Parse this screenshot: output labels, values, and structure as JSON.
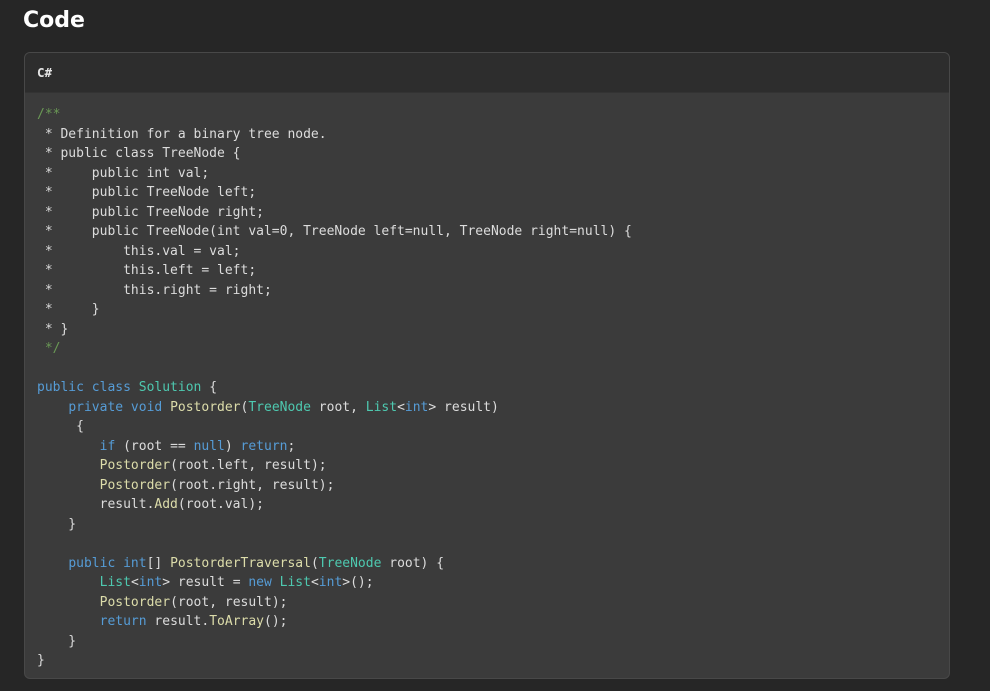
{
  "page": {
    "heading": "Code"
  },
  "code_block": {
    "language": "C#",
    "colors": {
      "plain": "#dcdcdc",
      "keyword": "#569cd6",
      "type": "#4ec9b0",
      "func": "#dcdcaa",
      "comment": "#6a9955"
    },
    "lines": [
      [
        [
          "comment",
          "/**"
        ]
      ],
      [
        [
          "plain",
          " * Definition for a binary tree node."
        ]
      ],
      [
        [
          "plain",
          " * public class TreeNode {"
        ]
      ],
      [
        [
          "plain",
          " *     public int val;"
        ]
      ],
      [
        [
          "plain",
          " *     public TreeNode left;"
        ]
      ],
      [
        [
          "plain",
          " *     public TreeNode right;"
        ]
      ],
      [
        [
          "plain",
          " *     public TreeNode(int val=0, TreeNode left=null, TreeNode right=null) {"
        ]
      ],
      [
        [
          "plain",
          " *         this.val = val;"
        ]
      ],
      [
        [
          "plain",
          " *         this.left = left;"
        ]
      ],
      [
        [
          "plain",
          " *         this.right = right;"
        ]
      ],
      [
        [
          "plain",
          " *     }"
        ]
      ],
      [
        [
          "plain",
          " * }"
        ]
      ],
      [
        [
          "comment",
          " */"
        ]
      ],
      [],
      [
        [
          "keyword",
          "public class "
        ],
        [
          "type",
          "Solution"
        ],
        [
          "plain",
          " {"
        ]
      ],
      [
        [
          "plain",
          "    "
        ],
        [
          "keyword",
          "private void "
        ],
        [
          "func",
          "Postorder"
        ],
        [
          "plain",
          "("
        ],
        [
          "type",
          "TreeNode"
        ],
        [
          "plain",
          " root, "
        ],
        [
          "type",
          "List"
        ],
        [
          "plain",
          "<"
        ],
        [
          "keyword",
          "int"
        ],
        [
          "plain",
          "> result)"
        ]
      ],
      [
        [
          "plain",
          "     {"
        ]
      ],
      [
        [
          "plain",
          "        "
        ],
        [
          "keyword",
          "if"
        ],
        [
          "plain",
          " (root == "
        ],
        [
          "keyword",
          "null"
        ],
        [
          "plain",
          ") "
        ],
        [
          "keyword",
          "return"
        ],
        [
          "plain",
          ";"
        ]
      ],
      [
        [
          "plain",
          "        "
        ],
        [
          "func",
          "Postorder"
        ],
        [
          "plain",
          "(root.left, result);"
        ]
      ],
      [
        [
          "plain",
          "        "
        ],
        [
          "func",
          "Postorder"
        ],
        [
          "plain",
          "(root.right, result);"
        ]
      ],
      [
        [
          "plain",
          "        result."
        ],
        [
          "func",
          "Add"
        ],
        [
          "plain",
          "(root.val);"
        ]
      ],
      [
        [
          "plain",
          "    }"
        ]
      ],
      [],
      [
        [
          "plain",
          "    "
        ],
        [
          "keyword",
          "public int"
        ],
        [
          "plain",
          "[] "
        ],
        [
          "func",
          "PostorderTraversal"
        ],
        [
          "plain",
          "("
        ],
        [
          "type",
          "TreeNode"
        ],
        [
          "plain",
          " root) {"
        ]
      ],
      [
        [
          "plain",
          "        "
        ],
        [
          "type",
          "List"
        ],
        [
          "plain",
          "<"
        ],
        [
          "keyword",
          "int"
        ],
        [
          "plain",
          "> result = "
        ],
        [
          "keyword",
          "new "
        ],
        [
          "type",
          "List"
        ],
        [
          "plain",
          "<"
        ],
        [
          "keyword",
          "int"
        ],
        [
          "plain",
          ">();"
        ]
      ],
      [
        [
          "plain",
          "        "
        ],
        [
          "func",
          "Postorder"
        ],
        [
          "plain",
          "(root, result);"
        ]
      ],
      [
        [
          "plain",
          "        "
        ],
        [
          "keyword",
          "return"
        ],
        [
          "plain",
          " result."
        ],
        [
          "func",
          "ToArray"
        ],
        [
          "plain",
          "();"
        ]
      ],
      [
        [
          "plain",
          "    }"
        ]
      ],
      [
        [
          "plain",
          "}"
        ]
      ]
    ]
  }
}
